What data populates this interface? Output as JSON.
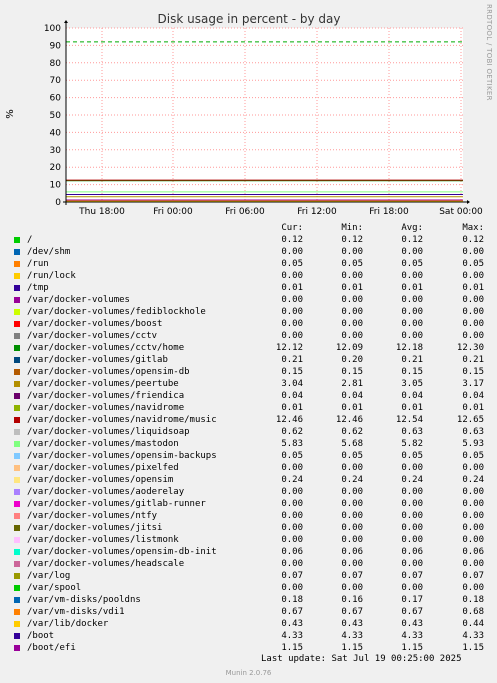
{
  "chart_data": {
    "type": "line",
    "title": "Disk usage in percent - by day",
    "ylabel": "%",
    "ylim": [
      0,
      100
    ],
    "y_ticks": [
      0,
      10,
      20,
      30,
      40,
      50,
      60,
      70,
      80,
      90,
      100
    ],
    "x_ticks": [
      "Thu 18:00",
      "Fri 00:00",
      "Fri 06:00",
      "Fri 12:00",
      "Fri 18:00",
      "Sat 00:00"
    ],
    "grid": true,
    "warning_line": 92,
    "series": [
      {
        "name": "/",
        "color": "#00cc00",
        "cur": "0.12",
        "min": "0.12",
        "avg": "0.12",
        "max": "0.12"
      },
      {
        "name": "/dev/shm",
        "color": "#0066b3",
        "cur": "0.00",
        "min": "0.00",
        "avg": "0.00",
        "max": "0.00"
      },
      {
        "name": "/run",
        "color": "#ff8000",
        "cur": "0.05",
        "min": "0.05",
        "avg": "0.05",
        "max": "0.05"
      },
      {
        "name": "/run/lock",
        "color": "#ffcc00",
        "cur": "0.00",
        "min": "0.00",
        "avg": "0.00",
        "max": "0.00"
      },
      {
        "name": "/tmp",
        "color": "#330099",
        "cur": "0.01",
        "min": "0.01",
        "avg": "0.01",
        "max": "0.01"
      },
      {
        "name": "/var/docker-volumes",
        "color": "#990099",
        "cur": "0.00",
        "min": "0.00",
        "avg": "0.00",
        "max": "0.00"
      },
      {
        "name": "/var/docker-volumes/fediblockhole",
        "color": "#ccff00",
        "cur": "0.00",
        "min": "0.00",
        "avg": "0.00",
        "max": "0.00"
      },
      {
        "name": "/var/docker-volumes/boost",
        "color": "#ff0000",
        "cur": "0.00",
        "min": "0.00",
        "avg": "0.00",
        "max": "0.00"
      },
      {
        "name": "/var/docker-volumes/cctv",
        "color": "#808080",
        "cur": "0.00",
        "min": "0.00",
        "avg": "0.00",
        "max": "0.00"
      },
      {
        "name": "/var/docker-volumes/cctv/home",
        "color": "#008f00",
        "cur": "12.12",
        "min": "12.09",
        "avg": "12.18",
        "max": "12.30"
      },
      {
        "name": "/var/docker-volumes/gitlab",
        "color": "#00487d",
        "cur": "0.21",
        "min": "0.20",
        "avg": "0.21",
        "max": "0.21"
      },
      {
        "name": "/var/docker-volumes/opensim-db",
        "color": "#b35a00",
        "cur": "0.15",
        "min": "0.15",
        "avg": "0.15",
        "max": "0.15"
      },
      {
        "name": "/var/docker-volumes/peertube",
        "color": "#b38f00",
        "cur": "3.04",
        "min": "2.81",
        "avg": "3.05",
        "max": "3.17"
      },
      {
        "name": "/var/docker-volumes/friendica",
        "color": "#6b006b",
        "cur": "0.04",
        "min": "0.04",
        "avg": "0.04",
        "max": "0.04"
      },
      {
        "name": "/var/docker-volumes/navidrome",
        "color": "#8fb300",
        "cur": "0.01",
        "min": "0.01",
        "avg": "0.01",
        "max": "0.01"
      },
      {
        "name": "/var/docker-volumes/navidrome/music",
        "color": "#b30000",
        "cur": "12.46",
        "min": "12.46",
        "avg": "12.54",
        "max": "12.65"
      },
      {
        "name": "/var/docker-volumes/liquidsoap",
        "color": "#bebebe",
        "cur": "0.62",
        "min": "0.62",
        "avg": "0.63",
        "max": "0.63"
      },
      {
        "name": "/var/docker-volumes/mastodon",
        "color": "#80ff80",
        "cur": "5.83",
        "min": "5.68",
        "avg": "5.82",
        "max": "5.93"
      },
      {
        "name": "/var/docker-volumes/opensim-backups",
        "color": "#80c9ff",
        "cur": "0.05",
        "min": "0.05",
        "avg": "0.05",
        "max": "0.05"
      },
      {
        "name": "/var/docker-volumes/pixelfed",
        "color": "#ffc080",
        "cur": "0.00",
        "min": "0.00",
        "avg": "0.00",
        "max": "0.00"
      },
      {
        "name": "/var/docker-volumes/opensim",
        "color": "#ffe680",
        "cur": "0.24",
        "min": "0.24",
        "avg": "0.24",
        "max": "0.24"
      },
      {
        "name": "/var/docker-volumes/aoderelay",
        "color": "#aa80ff",
        "cur": "0.00",
        "min": "0.00",
        "avg": "0.00",
        "max": "0.00"
      },
      {
        "name": "/var/docker-volumes/gitlab-runner",
        "color": "#ee00cc",
        "cur": "0.00",
        "min": "0.00",
        "avg": "0.00",
        "max": "0.00"
      },
      {
        "name": "/var/docker-volumes/ntfy",
        "color": "#ff8080",
        "cur": "0.00",
        "min": "0.00",
        "avg": "0.00",
        "max": "0.00"
      },
      {
        "name": "/var/docker-volumes/jitsi",
        "color": "#666600",
        "cur": "0.00",
        "min": "0.00",
        "avg": "0.00",
        "max": "0.00"
      },
      {
        "name": "/var/docker-volumes/listmonk",
        "color": "#ffbfff",
        "cur": "0.00",
        "min": "0.00",
        "avg": "0.00",
        "max": "0.00"
      },
      {
        "name": "/var/docker-volumes/opensim-db-init",
        "color": "#00ffcc",
        "cur": "0.06",
        "min": "0.06",
        "avg": "0.06",
        "max": "0.06"
      },
      {
        "name": "/var/docker-volumes/headscale",
        "color": "#cc6699",
        "cur": "0.00",
        "min": "0.00",
        "avg": "0.00",
        "max": "0.00"
      },
      {
        "name": "/var/log",
        "color": "#999900",
        "cur": "0.07",
        "min": "0.07",
        "avg": "0.07",
        "max": "0.07"
      },
      {
        "name": "/var/spool",
        "color": "#00cc00",
        "cur": "0.00",
        "min": "0.00",
        "avg": "0.00",
        "max": "0.00"
      },
      {
        "name": "/var/vm-disks/pooldns",
        "color": "#0066b3",
        "cur": "0.18",
        "min": "0.16",
        "avg": "0.17",
        "max": "0.18"
      },
      {
        "name": "/var/vm-disks/vdi1",
        "color": "#ff8000",
        "cur": "0.67",
        "min": "0.67",
        "avg": "0.67",
        "max": "0.68"
      },
      {
        "name": "/var/lib/docker",
        "color": "#ffcc00",
        "cur": "0.43",
        "min": "0.43",
        "avg": "0.43",
        "max": "0.44"
      },
      {
        "name": "/boot",
        "color": "#330099",
        "cur": "4.33",
        "min": "4.33",
        "avg": "4.33",
        "max": "4.33"
      },
      {
        "name": "/boot/efi",
        "color": "#990099",
        "cur": "1.15",
        "min": "1.15",
        "avg": "1.15",
        "max": "1.15"
      }
    ]
  },
  "legend_header": {
    "cur": "Cur:",
    "min": "Min:",
    "avg": "Avg:",
    "max": "Max:"
  },
  "side_note": "RRDTOOL / TOBI OETIKER",
  "last_update": "Last update:  Sat Jul 19 00:25:00 2025",
  "footer": "Munin 2.0.76"
}
